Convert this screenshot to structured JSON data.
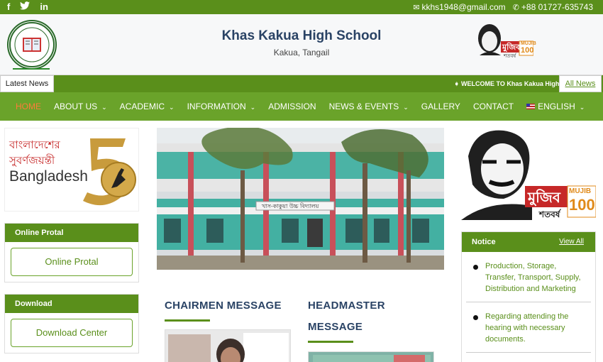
{
  "topbar": {
    "social": [
      "f",
      "twitter",
      "in"
    ],
    "email": "kkhs1948@gmail.com",
    "phone": "+88 01727-635743"
  },
  "header": {
    "title": "Khas Kakua High School",
    "subtitle": "Kakua, Tangail",
    "mujib_badge_bn": "মুজিব",
    "mujib_badge_en": "MUJIB",
    "mujib_badge_num": "100",
    "mujib_badge_sub": "শতবর্ষ"
  },
  "news": {
    "label": "Latest News",
    "ticker": "WELCOME TO Khas Kakua High",
    "all_news": "All News"
  },
  "nav": {
    "items": [
      "HOME",
      "ABOUT US",
      "ACADEMIC",
      "INFORMATION",
      "ADMISSION",
      "NEWS & EVENTS",
      "GALLERY",
      "CONTACT",
      "ENGLISH"
    ]
  },
  "left": {
    "bd50_bn_line1": "বাংলাদেশের",
    "bd50_bn_line2": "সুবর্ণজয়ন্তী",
    "bd50_en": "Bangladesh",
    "bd50_num": "50",
    "online_head": "Online Protal",
    "online_btn": "Online Protal",
    "download_head": "Download",
    "download_btn": "Download Center"
  },
  "hero": {
    "signboard": "খাস-কাকুয়া উচ্চ বিদ্যালয়"
  },
  "messages": {
    "chairmen": "CHAIRMEN MESSAGE",
    "headmaster_line1": "HEADMASTER",
    "headmaster_line2": "MESSAGE"
  },
  "notice": {
    "head": "Notice",
    "view_all": "View All",
    "items": [
      "Production, Storage, Transfer, Transport, Supply, Distribution and Marketing",
      "Regarding attending the hearing with necessary documents."
    ]
  },
  "colors": {
    "primary_green": "#5a8f1b",
    "nav_green": "#6aa32a",
    "active_orange": "#ff7b3a",
    "title_blue": "#2a4365"
  }
}
